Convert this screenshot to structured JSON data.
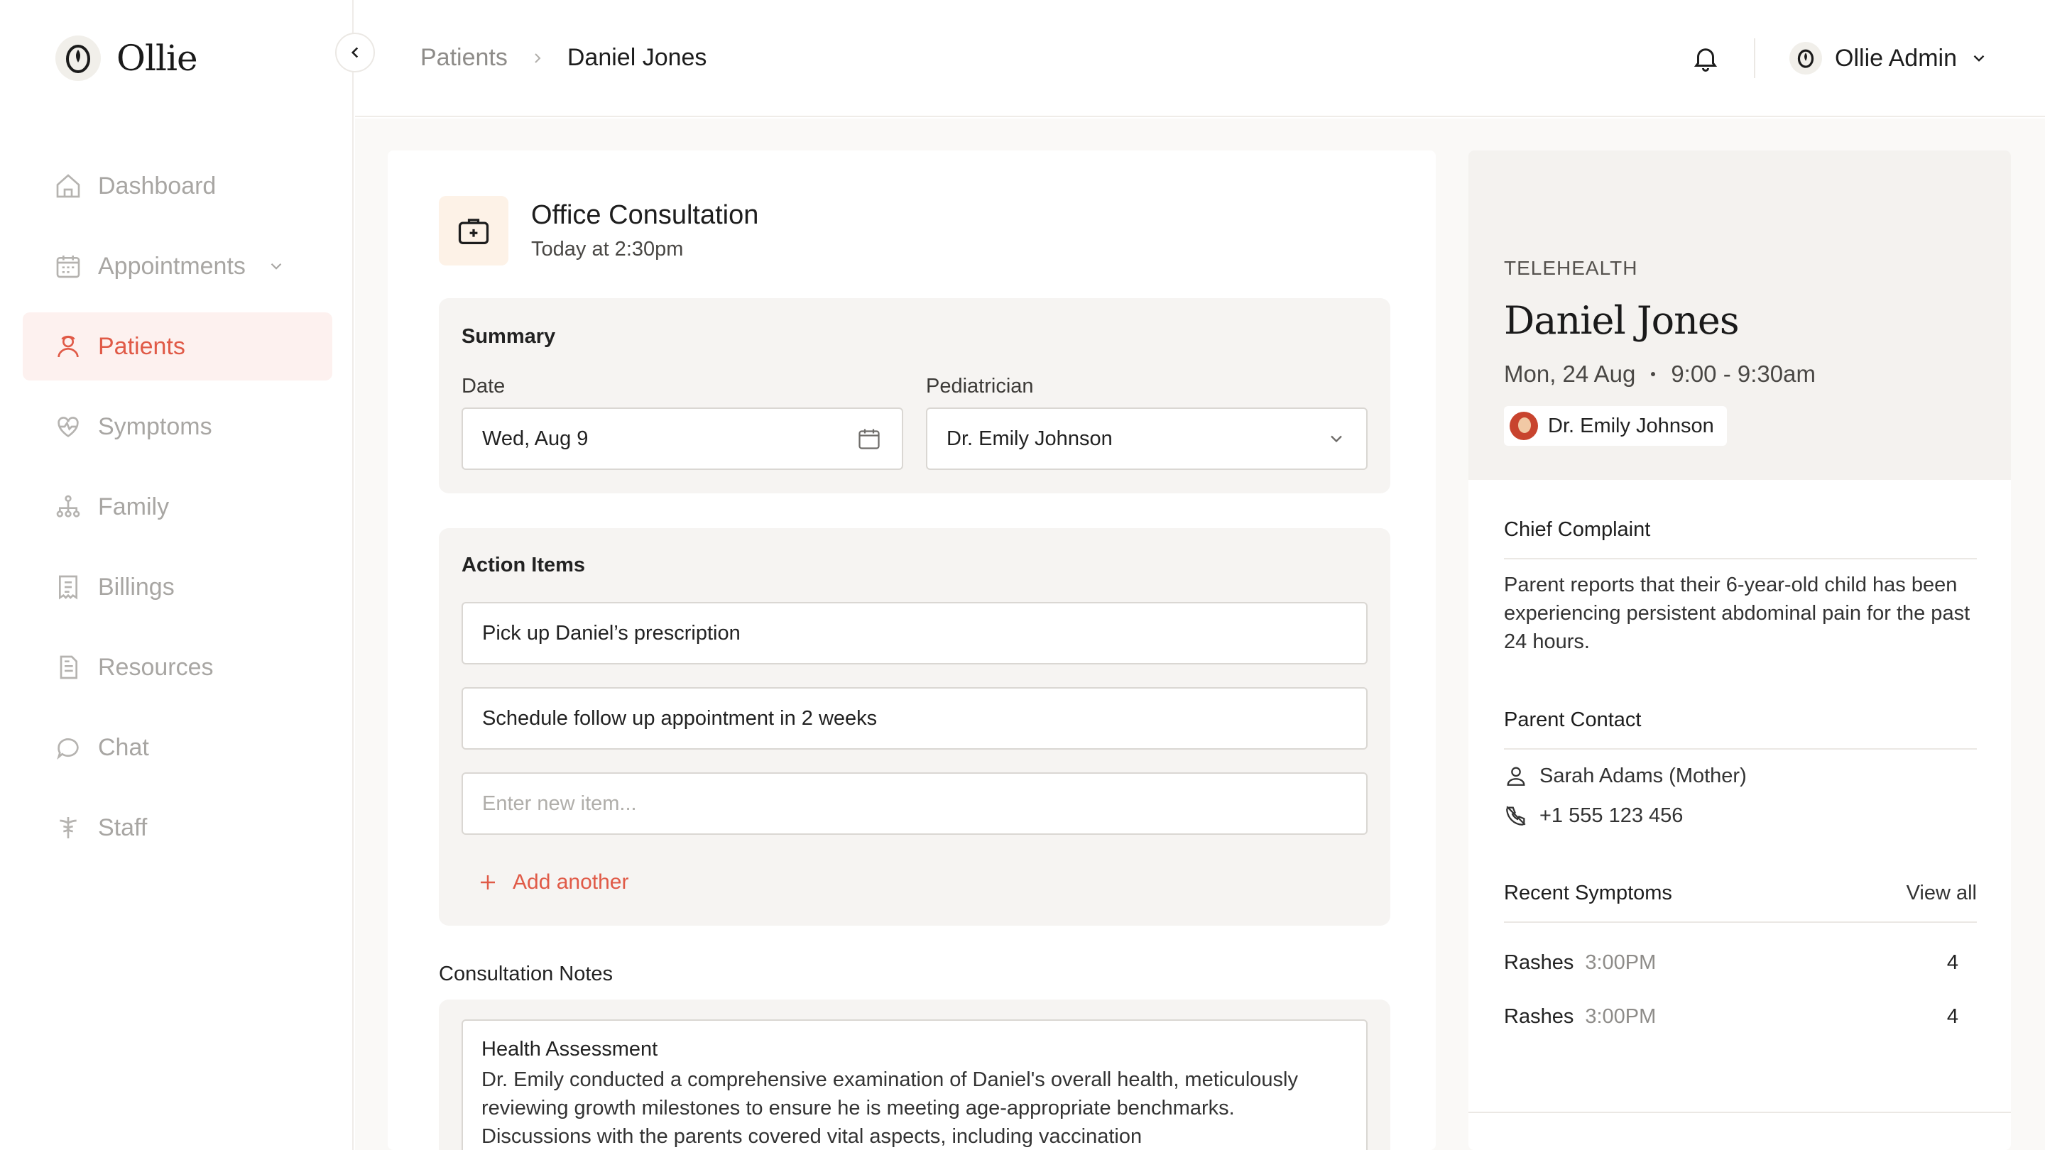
{
  "app": {
    "name": "Ollie",
    "accent": "#e05a47"
  },
  "sidebar": {
    "items": [
      {
        "label": "Dashboard",
        "icon": "home-icon"
      },
      {
        "label": "Appointments",
        "icon": "calendar-icon",
        "has_chevron": true
      },
      {
        "label": "Patients",
        "icon": "patients-icon",
        "active": true
      },
      {
        "label": "Symptoms",
        "icon": "heart-pulse-icon"
      },
      {
        "label": "Family",
        "icon": "family-tree-icon"
      },
      {
        "label": "Billings",
        "icon": "receipt-icon"
      },
      {
        "label": "Resources",
        "icon": "document-icon"
      },
      {
        "label": "Chat",
        "icon": "chat-icon"
      },
      {
        "label": "Staff",
        "icon": "caduceus-icon"
      }
    ]
  },
  "header": {
    "breadcrumb": [
      "Patients",
      "Daniel Jones"
    ],
    "user_name": "Ollie Admin"
  },
  "consultation": {
    "title": "Office Consultation",
    "subtitle": "Today at 2:30pm"
  },
  "summary": {
    "title": "Summary",
    "date_label": "Date",
    "date_value": "Wed, Aug 9",
    "pediatrician_label": "Pediatrician",
    "pediatrician_value": "Dr. Emily Johnson"
  },
  "action_items": {
    "title": "Action Items",
    "items": [
      "Pick up Daniel’s prescription",
      "Schedule follow up appointment in 2 weeks"
    ],
    "new_item_placeholder": "Enter new item...",
    "add_label": "Add another"
  },
  "notes": {
    "label": "Consultation Notes",
    "heading": "Health Assessment",
    "body": "Dr. Emily conducted a comprehensive examination of Daniel's overall health, meticulously reviewing growth milestones to ensure he is meeting age-appropriate benchmarks. Discussions with the parents covered vital aspects, including vaccination"
  },
  "patient_panel": {
    "type": "TELEHEALTH",
    "name": "Daniel Jones",
    "date": "Mon, 24 Aug",
    "time": "9:00 - 9:30am",
    "doctor": "Dr. Emily Johnson",
    "chief_complaint_title": "Chief Complaint",
    "chief_complaint": "Parent reports that their 6-year-old child has been experiencing persistent abdominal pain for the past 24 hours.",
    "parent_contact_title": "Parent Contact",
    "parent_name": "Sarah Adams (Mother)",
    "parent_phone": "+1 555 123 456",
    "recent_symptoms_title": "Recent Symptoms",
    "view_all": "View all",
    "symptoms": [
      {
        "name": "Rashes",
        "time": "3:00PM",
        "count": "4"
      },
      {
        "name": "Rashes",
        "time": "3:00PM",
        "count": "4"
      }
    ]
  }
}
